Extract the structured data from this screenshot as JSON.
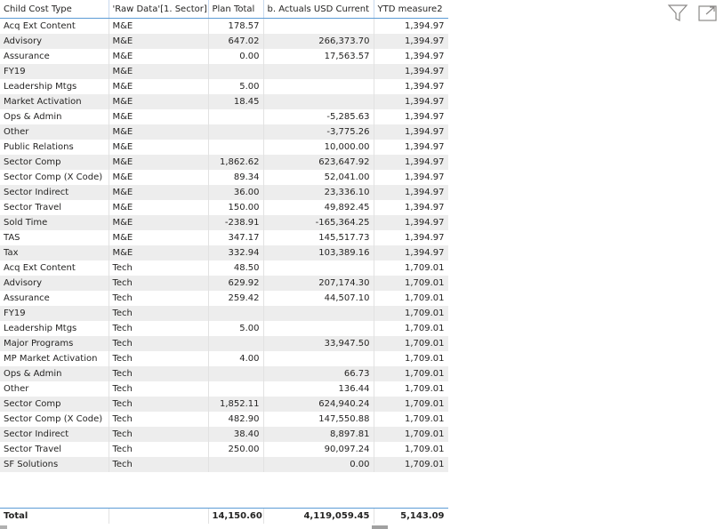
{
  "table": {
    "columns": [
      "Child Cost Type",
      "'Raw Data'[1. Sector]",
      "Plan Total",
      "b. Actuals USD Current",
      "YTD measure2"
    ],
    "rows": [
      [
        "Acq Ext Content",
        "M&E",
        "178.57",
        "",
        "1,394.97"
      ],
      [
        "Advisory",
        "M&E",
        "647.02",
        "266,373.70",
        "1,394.97"
      ],
      [
        "Assurance",
        "M&E",
        "0.00",
        "17,563.57",
        "1,394.97"
      ],
      [
        "FY19",
        "M&E",
        "",
        "",
        "1,394.97"
      ],
      [
        "Leadership Mtgs",
        "M&E",
        "5.00",
        "",
        "1,394.97"
      ],
      [
        "Market Activation",
        "M&E",
        "18.45",
        "",
        "1,394.97"
      ],
      [
        "Ops & Admin",
        "M&E",
        "",
        "-5,285.63",
        "1,394.97"
      ],
      [
        "Other",
        "M&E",
        "",
        "-3,775.26",
        "1,394.97"
      ],
      [
        "Public Relations",
        "M&E",
        "",
        "10,000.00",
        "1,394.97"
      ],
      [
        "Sector Comp",
        "M&E",
        "1,862.62",
        "623,647.92",
        "1,394.97"
      ],
      [
        "Sector Comp (X Code)",
        "M&E",
        "89.34",
        "52,041.00",
        "1,394.97"
      ],
      [
        "Sector Indirect",
        "M&E",
        "36.00",
        "23,336.10",
        "1,394.97"
      ],
      [
        "Sector Travel",
        "M&E",
        "150.00",
        "49,892.45",
        "1,394.97"
      ],
      [
        "Sold Time",
        "M&E",
        "-238.91",
        "-165,364.25",
        "1,394.97"
      ],
      [
        "TAS",
        "M&E",
        "347.17",
        "145,517.73",
        "1,394.97"
      ],
      [
        "Tax",
        "M&E",
        "332.94",
        "103,389.16",
        "1,394.97"
      ],
      [
        "Acq Ext Content",
        "Tech",
        "48.50",
        "",
        "1,709.01"
      ],
      [
        "Advisory",
        "Tech",
        "629.92",
        "207,174.30",
        "1,709.01"
      ],
      [
        "Assurance",
        "Tech",
        "259.42",
        "44,507.10",
        "1,709.01"
      ],
      [
        "FY19",
        "Tech",
        "",
        "",
        "1,709.01"
      ],
      [
        "Leadership Mtgs",
        "Tech",
        "5.00",
        "",
        "1,709.01"
      ],
      [
        "Major Programs",
        "Tech",
        "",
        "33,947.50",
        "1,709.01"
      ],
      [
        "MP Market Activation",
        "Tech",
        "4.00",
        "",
        "1,709.01"
      ],
      [
        "Ops & Admin",
        "Tech",
        "",
        "66.73",
        "1,709.01"
      ],
      [
        "Other",
        "Tech",
        "",
        "136.44",
        "1,709.01"
      ],
      [
        "Sector Comp",
        "Tech",
        "1,852.11",
        "624,940.24",
        "1,709.01"
      ],
      [
        "Sector Comp (X Code)",
        "Tech",
        "482.90",
        "147,550.88",
        "1,709.01"
      ],
      [
        "Sector Indirect",
        "Tech",
        "38.40",
        "8,897.81",
        "1,709.01"
      ],
      [
        "Sector Travel",
        "Tech",
        "250.00",
        "90,097.24",
        "1,709.01"
      ],
      [
        "SF Solutions",
        "Tech",
        "",
        "0.00",
        "1,709.01"
      ]
    ],
    "total": [
      "Total",
      "",
      "14,150.60",
      "4,119,059.45",
      "5,143.09"
    ]
  },
  "toolbar": {
    "filter_icon": "filter-icon",
    "focus_icon": "focus-mode-icon"
  },
  "colors": {
    "accent": "#5b9bd5",
    "row_alt": "#ededed",
    "text": "#252423"
  }
}
